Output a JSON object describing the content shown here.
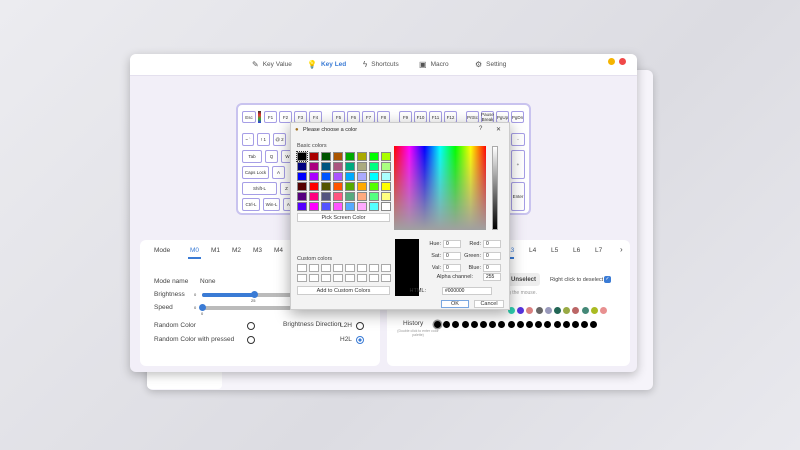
{
  "nav": [
    {
      "label": "Key Value",
      "icon": "key-value-icon"
    },
    {
      "label": "Key Led",
      "icon": "bulb-icon",
      "active": true
    },
    {
      "label": "Shortcuts",
      "icon": "lightning-icon"
    },
    {
      "label": "Macro",
      "icon": "monitor-icon"
    },
    {
      "label": "Setting",
      "icon": "gear-icon"
    }
  ],
  "keyboard": {
    "row1": [
      "Esc",
      "F1",
      "F2",
      "F3",
      "F4",
      "F5",
      "F6",
      "F7",
      "F8",
      "F9",
      "F10",
      "F11",
      "F12",
      "PrtSc",
      "Pause Break",
      "PgUp",
      "PgDn"
    ],
    "row2": [
      "~ `",
      "! 1",
      "@ 2"
    ],
    "row3": [
      "Tab",
      "Q",
      "W"
    ],
    "row4": [
      "Caps Lock",
      "A"
    ],
    "row5": [
      "Shift-L",
      "Z"
    ],
    "row6": [
      "Ctrl-L",
      "Win-L",
      "Alt"
    ],
    "right": [
      "-",
      "+",
      "Enter"
    ]
  },
  "left_panel": {
    "mode_label": "Mode",
    "modes": [
      "M0",
      "M1",
      "M2",
      "M3",
      "M4"
    ],
    "active_mode": "M0",
    "mode_name_label": "Mode name",
    "mode_name": "None",
    "brightness_label": "Brightness",
    "brightness_min": "0",
    "brightness_value": "25",
    "brightness_fraction": 0.52,
    "speed_label": "Speed",
    "speed_min": "0",
    "speed_value": "0",
    "random_color_label": "Random Color",
    "random_pressed_label": "Random Color with pressed",
    "brightness_direction_label": "Brightness Direction",
    "l2h": "L2H",
    "h2l": "H2L"
  },
  "right_panel": {
    "tabs": [
      "L3",
      "L4",
      "L5",
      "L6",
      "L7"
    ],
    "unselect": "Unselect",
    "right_click_label": "Right click to deselect",
    "hint": "...ing the mouse.",
    "history_label": "History",
    "history_hint": "(Double click to enter color palette)",
    "palette": [
      "#2ecfb0",
      "#5533dd",
      "#d88080",
      "#666666",
      "#9999bb",
      "#226655",
      "#99aa44",
      "#bb6666",
      "#448877",
      "#aabb22",
      "#e89090"
    ],
    "history_count": 18
  },
  "dialog": {
    "title": "Please choose a color",
    "help": "?",
    "close": "✕",
    "basic_label": "Basic colors",
    "basic_colors": [
      "#000000",
      "#aa0000",
      "#005500",
      "#aa5500",
      "#00aa00",
      "#aaaa00",
      "#00ff00",
      "#aaff00",
      "#00007f",
      "#aa007f",
      "#00557f",
      "#aa557f",
      "#00aa7f",
      "#aaaa7f",
      "#00ff7f",
      "#aaff7f",
      "#0000ff",
      "#aa00ff",
      "#0055ff",
      "#aa55ff",
      "#00aaff",
      "#aaaaff",
      "#00ffff",
      "#aaffff",
      "#550000",
      "#ff0000",
      "#555500",
      "#ff5500",
      "#55aa00",
      "#ffaa00",
      "#55ff00",
      "#ffff00",
      "#55007f",
      "#ff007f",
      "#55557f",
      "#ff557f",
      "#55aa7f",
      "#ffaa7f",
      "#55ff7f",
      "#ffff7f",
      "#5500ff",
      "#ff00ff",
      "#5555ff",
      "#ff55ff",
      "#55aaff",
      "#ffaaff",
      "#55ffff",
      "#ffffff"
    ],
    "pick_screen": "Pick Screen Color",
    "custom_label": "Custom colors",
    "add_custom": "Add to Custom Colors",
    "hue_label": "Hue:",
    "hue": "0",
    "sat_label": "Sat:",
    "sat": "0",
    "val_label": "Val:",
    "val": "0",
    "red_label": "Red:",
    "red": "0",
    "green_label": "Green:",
    "green": "0",
    "blue_label": "Blue:",
    "blue": "0",
    "alpha_label": "Alpha channel:",
    "alpha": "255",
    "html_label": "HTML:",
    "html": "#000000",
    "ok": "OK",
    "cancel": "Cancel"
  }
}
